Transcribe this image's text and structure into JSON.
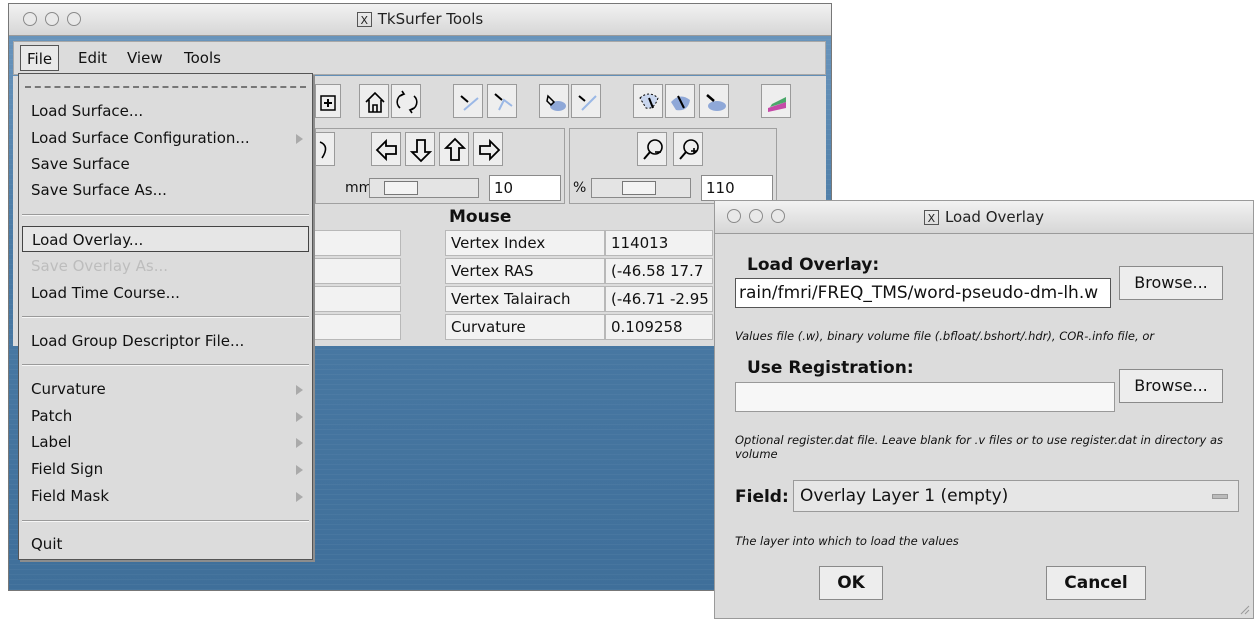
{
  "main_window": {
    "title": "TkSurfer Tools",
    "menus": [
      "File",
      "Edit",
      "View",
      "Tools"
    ],
    "toolbar_icons": [
      "add-icon",
      "home-icon",
      "rotate-icon",
      "edge-icon",
      "path-icon",
      "fill-icon",
      "custom-cut-icon",
      "cut-area-icon",
      "cut-plane-icon",
      "cut-label-icon",
      "colorbar-icon"
    ],
    "nav": {
      "mm_label": "mm",
      "mm_value": "10",
      "percent_label": "%",
      "percent_value": "110"
    },
    "mouse": {
      "header": "Mouse",
      "rows": [
        {
          "label": "Vertex Index",
          "value": "114013"
        },
        {
          "label": "Vertex RAS",
          "value": "(-46.58  17.7"
        },
        {
          "label": "Vertex Talairach",
          "value": "(-46.71  -2.95"
        },
        {
          "label": "Curvature",
          "value": "0.109258"
        }
      ]
    }
  },
  "file_menu": {
    "items": [
      {
        "label": "Load Surface...",
        "submenu": false
      },
      {
        "label": "Load Surface Configuration...",
        "submenu": true
      },
      {
        "label": "Save Surface",
        "submenu": false
      },
      {
        "label": "Save Surface As...",
        "submenu": false
      },
      {
        "label": "Load Overlay...",
        "submenu": false,
        "highlighted": true
      },
      {
        "label": "Save Overlay As...",
        "submenu": false,
        "disabled": true
      },
      {
        "label": "Load Time Course...",
        "submenu": false
      },
      {
        "label": "Load Group Descriptor File...",
        "submenu": false
      },
      {
        "label": "Curvature",
        "submenu": true
      },
      {
        "label": "Patch",
        "submenu": true
      },
      {
        "label": "Label",
        "submenu": true
      },
      {
        "label": "Field Sign",
        "submenu": true
      },
      {
        "label": "Field Mask",
        "submenu": true
      },
      {
        "label": "Quit",
        "submenu": false
      }
    ]
  },
  "dialog": {
    "title": "Load Overlay",
    "overlay_label": "Load Overlay:",
    "overlay_value": "rain/fmri/FREQ_TMS/word-pseudo-dm-lh.w",
    "browse1": "Browse...",
    "overlay_hint": "Values file (.w), binary volume file (.bfloat/.bshort/.hdr), COR-.info file, or",
    "registration_label": "Use Registration:",
    "registration_value": "",
    "browse2": "Browse...",
    "registration_hint": "Optional register.dat file. Leave blank for .v files or to use register.dat in directory as volume",
    "field_label": "Field:",
    "field_value": "Overlay Layer 1 (empty)",
    "field_hint": "The layer into which to load the values",
    "ok": "OK",
    "cancel": "Cancel"
  }
}
